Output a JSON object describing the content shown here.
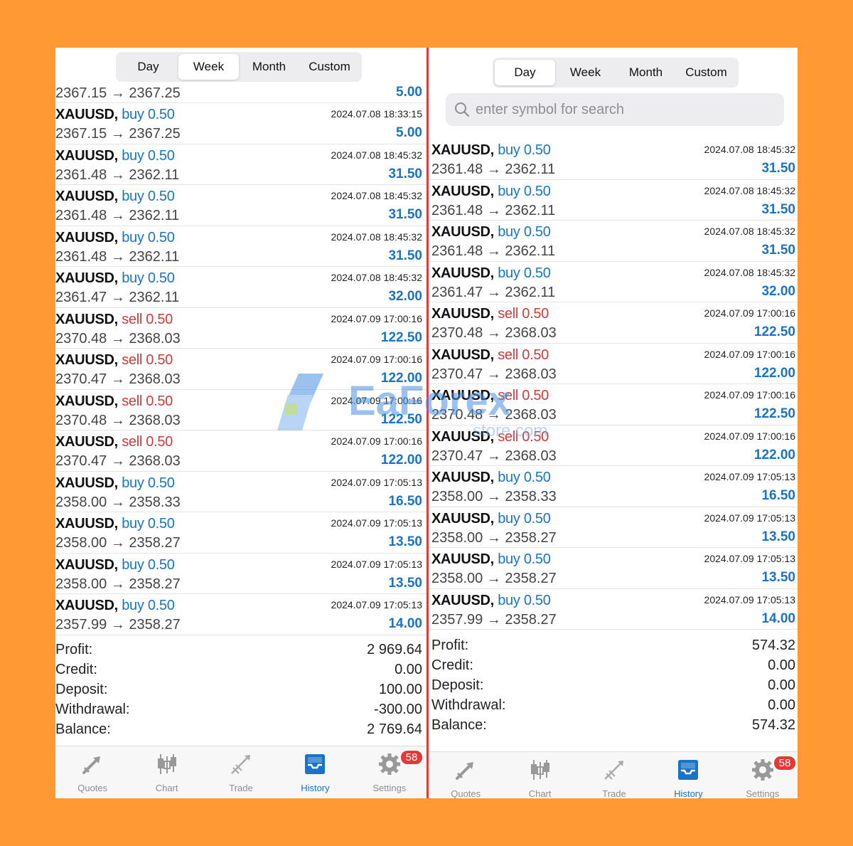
{
  "left": {
    "tabs": [
      "Day",
      "Week",
      "Month",
      "Custom"
    ],
    "active_tab": "Week",
    "partial_row": {
      "prices": "2367.15 → 2367.25",
      "profit": "5.00"
    },
    "rows": [
      {
        "symbol": "XAUUSD,",
        "side": "buy",
        "volume": "0.50",
        "time": "2024.07.08 18:33:15",
        "prices": "2367.15 → 2367.25",
        "profit": "5.00"
      },
      {
        "symbol": "XAUUSD,",
        "side": "buy",
        "volume": "0.50",
        "time": "2024.07.08 18:45:32",
        "prices": "2361.48 → 2362.11",
        "profit": "31.50"
      },
      {
        "symbol": "XAUUSD,",
        "side": "buy",
        "volume": "0.50",
        "time": "2024.07.08 18:45:32",
        "prices": "2361.48 → 2362.11",
        "profit": "31.50"
      },
      {
        "symbol": "XAUUSD,",
        "side": "buy",
        "volume": "0.50",
        "time": "2024.07.08 18:45:32",
        "prices": "2361.48 → 2362.11",
        "profit": "31.50"
      },
      {
        "symbol": "XAUUSD,",
        "side": "buy",
        "volume": "0.50",
        "time": "2024.07.08 18:45:32",
        "prices": "2361.47 → 2362.11",
        "profit": "32.00"
      },
      {
        "symbol": "XAUUSD,",
        "side": "sell",
        "volume": "0.50",
        "time": "2024.07.09 17:00:16",
        "prices": "2370.48 → 2368.03",
        "profit": "122.50"
      },
      {
        "symbol": "XAUUSD,",
        "side": "sell",
        "volume": "0.50",
        "time": "2024.07.09 17:00:16",
        "prices": "2370.47 → 2368.03",
        "profit": "122.00"
      },
      {
        "symbol": "XAUUSD,",
        "side": "sell",
        "volume": "0.50",
        "time": "2024.07.09 17:00:16",
        "prices": "2370.48 → 2368.03",
        "profit": "122.50"
      },
      {
        "symbol": "XAUUSD,",
        "side": "sell",
        "volume": "0.50",
        "time": "2024.07.09 17:00:16",
        "prices": "2370.47 → 2368.03",
        "profit": "122.00"
      },
      {
        "symbol": "XAUUSD,",
        "side": "buy",
        "volume": "0.50",
        "time": "2024.07.09 17:05:13",
        "prices": "2358.00 → 2358.33",
        "profit": "16.50"
      },
      {
        "symbol": "XAUUSD,",
        "side": "buy",
        "volume": "0.50",
        "time": "2024.07.09 17:05:13",
        "prices": "2358.00 → 2358.27",
        "profit": "13.50"
      },
      {
        "symbol": "XAUUSD,",
        "side": "buy",
        "volume": "0.50",
        "time": "2024.07.09 17:05:13",
        "prices": "2358.00 → 2358.27",
        "profit": "13.50"
      },
      {
        "symbol": "XAUUSD,",
        "side": "buy",
        "volume": "0.50",
        "time": "2024.07.09 17:05:13",
        "prices": "2357.99 → 2358.27",
        "profit": "14.00"
      }
    ],
    "summary": [
      {
        "label": "Profit:",
        "value": "2 969.64"
      },
      {
        "label": "Credit:",
        "value": "0.00"
      },
      {
        "label": "Deposit:",
        "value": "100.00"
      },
      {
        "label": "Withdrawal:",
        "value": "-300.00"
      },
      {
        "label": "Balance:",
        "value": "2 769.64"
      }
    ]
  },
  "right": {
    "tabs": [
      "Day",
      "Week",
      "Month",
      "Custom"
    ],
    "active_tab": "Day",
    "search": {
      "placeholder": "enter symbol for search"
    },
    "rows": [
      {
        "symbol": "XAUUSD,",
        "side": "buy",
        "volume": "0.50",
        "time": "2024.07.08 18:45:32",
        "prices": "2361.48 → 2362.11",
        "profit": "31.50"
      },
      {
        "symbol": "XAUUSD,",
        "side": "buy",
        "volume": "0.50",
        "time": "2024.07.08 18:45:32",
        "prices": "2361.48 → 2362.11",
        "profit": "31.50"
      },
      {
        "symbol": "XAUUSD,",
        "side": "buy",
        "volume": "0.50",
        "time": "2024.07.08 18:45:32",
        "prices": "2361.48 → 2362.11",
        "profit": "31.50"
      },
      {
        "symbol": "XAUUSD,",
        "side": "buy",
        "volume": "0.50",
        "time": "2024.07.08 18:45:32",
        "prices": "2361.47 → 2362.11",
        "profit": "32.00"
      },
      {
        "symbol": "XAUUSD,",
        "side": "sell",
        "volume": "0.50",
        "time": "2024.07.09 17:00:16",
        "prices": "2370.48 → 2368.03",
        "profit": "122.50"
      },
      {
        "symbol": "XAUUSD,",
        "side": "sell",
        "volume": "0.50",
        "time": "2024.07.09 17:00:16",
        "prices": "2370.47 → 2368.03",
        "profit": "122.00"
      },
      {
        "symbol": "XAUUSD,",
        "side": "sell",
        "volume": "0.50",
        "time": "2024.07.09 17:00:16",
        "prices": "2370.48 → 2368.03",
        "profit": "122.50"
      },
      {
        "symbol": "XAUUSD,",
        "side": "sell",
        "volume": "0.50",
        "time": "2024.07.09 17:00:16",
        "prices": "2370.47 → 2368.03",
        "profit": "122.00"
      },
      {
        "symbol": "XAUUSD,",
        "side": "buy",
        "volume": "0.50",
        "time": "2024.07.09 17:05:13",
        "prices": "2358.00 → 2358.33",
        "profit": "16.50"
      },
      {
        "symbol": "XAUUSD,",
        "side": "buy",
        "volume": "0.50",
        "time": "2024.07.09 17:05:13",
        "prices": "2358.00 → 2358.27",
        "profit": "13.50"
      },
      {
        "symbol": "XAUUSD,",
        "side": "buy",
        "volume": "0.50",
        "time": "2024.07.09 17:05:13",
        "prices": "2358.00 → 2358.27",
        "profit": "13.50"
      },
      {
        "symbol": "XAUUSD,",
        "side": "buy",
        "volume": "0.50",
        "time": "2024.07.09 17:05:13",
        "prices": "2357.99 → 2358.27",
        "profit": "14.00"
      }
    ],
    "summary": [
      {
        "label": "Profit:",
        "value": "574.32"
      },
      {
        "label": "Credit:",
        "value": "0.00"
      },
      {
        "label": "Deposit:",
        "value": "0.00"
      },
      {
        "label": "Withdrawal:",
        "value": "0.00"
      },
      {
        "label": "Balance:",
        "value": "574.32"
      }
    ]
  },
  "tabbar": {
    "items": [
      {
        "label": "Quotes",
        "icon": "quotes-icon"
      },
      {
        "label": "Chart",
        "icon": "candlestick-chart-icon"
      },
      {
        "label": "Trade",
        "icon": "trade-icon"
      },
      {
        "label": "History",
        "icon": "history-inbox-icon",
        "active": true
      },
      {
        "label": "Settings",
        "icon": "gear-icon",
        "badge": "58"
      }
    ]
  },
  "watermark": {
    "text": "EaForex",
    "sub": "store.com"
  },
  "colors": {
    "background": "#FF9933",
    "buy": "#1a73c8",
    "sell": "#d23a3a",
    "profit": "#1a73c8"
  }
}
